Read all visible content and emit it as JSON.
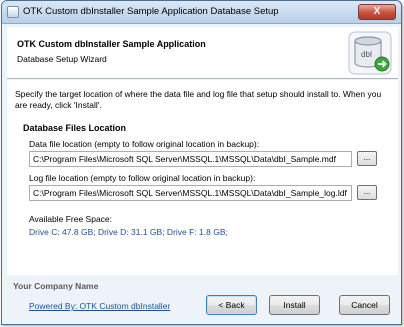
{
  "window": {
    "title": "OTK Custom dbInstaller Sample Application Database Setup",
    "close_label": "X"
  },
  "header": {
    "title": "OTK Custom dbInstaller Sample Application",
    "subtitle": "Database Setup Wizard",
    "icon": "database-icon"
  },
  "instructions": "Specify the target location of where the data file and log file that setup should install to. When you are ready, click 'Install'.",
  "group": {
    "title": "Database Files Location",
    "data_file": {
      "label": "Data file location (empty to follow original location in backup):",
      "value": "C:\\Program Files\\Microsoft SQL Server\\MSSQL.1\\MSSQL\\Data\\dbI_Sample.mdf",
      "browse_label": "..."
    },
    "log_file": {
      "label": "Log file location (empty to follow original location in backup):",
      "value": "C:\\Program Files\\Microsoft SQL Server\\MSSQL.1\\MSSQL\\Data\\dbI_Sample_log.ldf",
      "browse_label": "..."
    },
    "free_space_label": "Available Free Space:",
    "drives": "Drive C: 47.8 GB; Drive D: 31.1 GB; Drive F: 1.8 GB;"
  },
  "footer": {
    "company": "Your Company Name",
    "powered_by": "Powered By: OTK Custom dbInstaller",
    "back_label": "< Back",
    "install_label": "Install",
    "cancel_label": "Cancel"
  },
  "colors": {
    "link": "#1f4f9c",
    "close": "#c8503f",
    "title_bar": "#b7cfe8"
  }
}
